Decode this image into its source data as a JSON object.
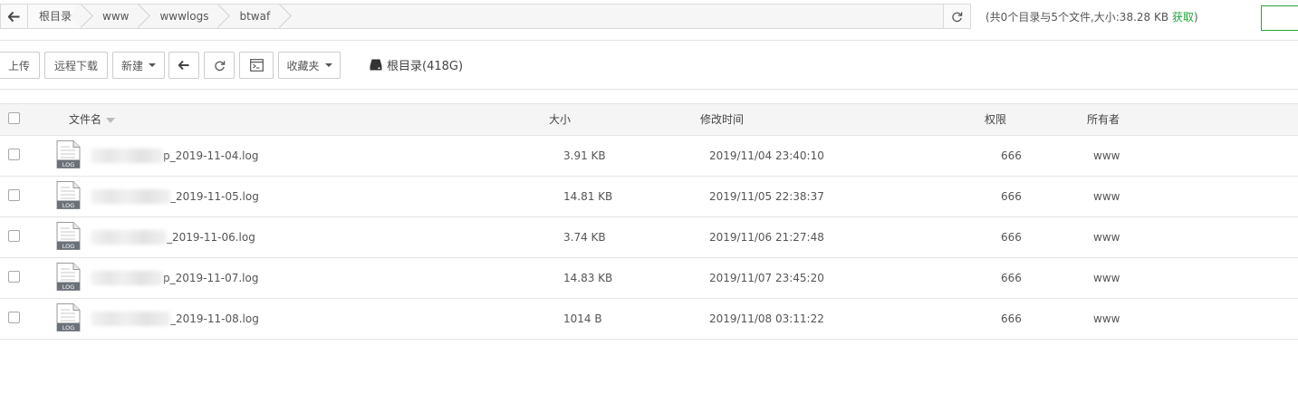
{
  "pathbar": {
    "crumbs": [
      "根目录",
      "www",
      "wwwlogs",
      "btwaf"
    ]
  },
  "summary": {
    "text": "(共0个目录与5个文件,大小:38.28 KB",
    "fetch_label": "获取",
    "close_paren": ")"
  },
  "toolbar": {
    "upload": "上传",
    "remote_download": "远程下载",
    "new": "新建",
    "favorites": "收藏夹",
    "disk_label": "根目录(418G)"
  },
  "table": {
    "headers": {
      "name": "文件名",
      "size": "大小",
      "mtime": "修改时间",
      "perm": "权限",
      "owner": "所有者"
    },
    "rows": [
      {
        "name_suffix": "p_2019-11-04.log",
        "size": "3.91 KB",
        "mtime": "2019/11/04 23:40:10",
        "perm": "666",
        "owner": "www"
      },
      {
        "name_suffix": "_2019-11-05.log",
        "size": "14.81 KB",
        "mtime": "2019/11/05 22:38:37",
        "perm": "666",
        "owner": "www"
      },
      {
        "name_suffix": "_2019-11-06.log",
        "size": "3.74 KB",
        "mtime": "2019/11/06 21:27:48",
        "perm": "666",
        "owner": "www"
      },
      {
        "name_suffix": "p_2019-11-07.log",
        "size": "14.83 KB",
        "mtime": "2019/11/07 23:45:20",
        "perm": "666",
        "owner": "www"
      },
      {
        "name_suffix": "_2019-11-08.log",
        "size": "1014 B",
        "mtime": "2019/11/08 03:11:22",
        "perm": "666",
        "owner": "www"
      }
    ],
    "file_icon_label": "LOG"
  },
  "colors": {
    "accent": "#20a53a",
    "border": "#e4e4e4",
    "header_bg": "#f5f5f5"
  },
  "icons": [
    "arrow-left-icon",
    "refresh-icon",
    "terminal-icon",
    "disk-icon",
    "log-file-icon"
  ]
}
